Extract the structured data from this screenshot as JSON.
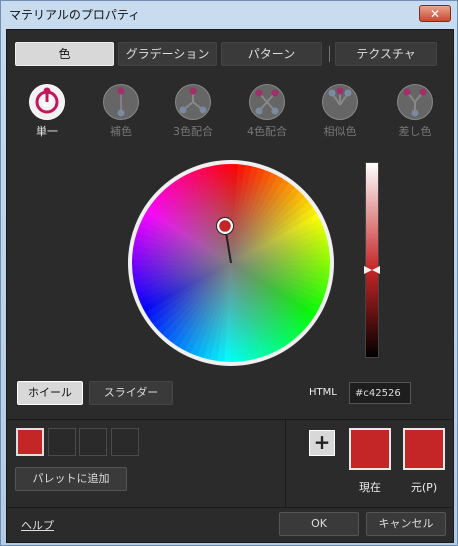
{
  "window": {
    "title": "マテリアルのプロパティ",
    "close_glyph": "✕"
  },
  "tabs": [
    {
      "label": "色",
      "active": true
    },
    {
      "label": "グラデーション",
      "active": false
    },
    {
      "label": "パターン",
      "active": false
    },
    {
      "label": "テクスチャ",
      "active": false
    }
  ],
  "modes": [
    {
      "label": "単一",
      "active": true,
      "icon": "single-color-icon"
    },
    {
      "label": "補色",
      "active": false,
      "icon": "complementary-color-icon"
    },
    {
      "label": "3色配合",
      "active": false,
      "icon": "triad-color-icon"
    },
    {
      "label": "4色配合",
      "active": false,
      "icon": "tetrad-color-icon"
    },
    {
      "label": "相似色",
      "active": false,
      "icon": "analogous-color-icon"
    },
    {
      "label": "差し色",
      "active": false,
      "icon": "accent-color-icon"
    }
  ],
  "picker": {
    "selected_color": "#c42526",
    "brightness_level": 0.55,
    "view_buttons": {
      "wheel": "ホイール",
      "slider": "スライダー"
    },
    "html_label": "HTML",
    "html_value": "#c42526"
  },
  "palette": {
    "swatches": [
      "#c42526",
      "",
      "",
      ""
    ],
    "add_button": "パレットに追加"
  },
  "preview": {
    "current_label": "現在",
    "original_label": "元(P)",
    "current_color": "#c42526",
    "original_color": "#c42526"
  },
  "footer": {
    "help": "ヘルプ",
    "ok": "OK",
    "cancel": "キャンセル"
  }
}
